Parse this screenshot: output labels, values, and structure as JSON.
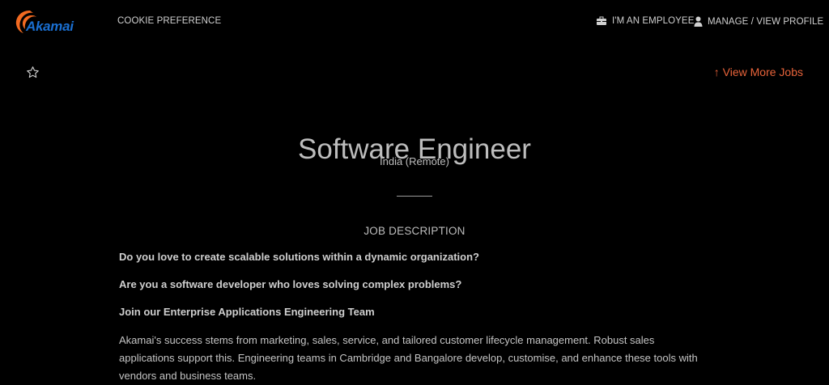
{
  "header": {
    "logo_text": "Akamai",
    "cookie_preference": "COOKIE PREFERENCE",
    "employee_link": "I'M AN EMPLOYEE",
    "profile_link": "MANAGE / VIEW PROFILE"
  },
  "actions": {
    "view_more_jobs": "↑ View More Jobs"
  },
  "job": {
    "title": "Software Engineer",
    "location": "India (Remote)",
    "description_heading": "JOB DESCRIPTION",
    "intro_lines": [
      "Do you love to create scalable solutions within a dynamic organization?",
      "Are you a software developer who loves solving complex problems?",
      "Join our Enterprise Applications Engineering Team"
    ],
    "paragraph": "Akamai's success stems from marketing, sales, service, and tailored customer lifecycle management. Robust sales applications support this. Engineering teams in Cambridge and Bangalore develop, customise, and enhance these tools with vendors and business teams."
  },
  "colors": {
    "background": "#000000",
    "accent": "#e8633a",
    "logo_blue": "#1a6fd1",
    "logo_orange": "#f26a21"
  },
  "icons": [
    "akamai-logo",
    "briefcase-icon",
    "user-icon",
    "star-icon"
  ]
}
